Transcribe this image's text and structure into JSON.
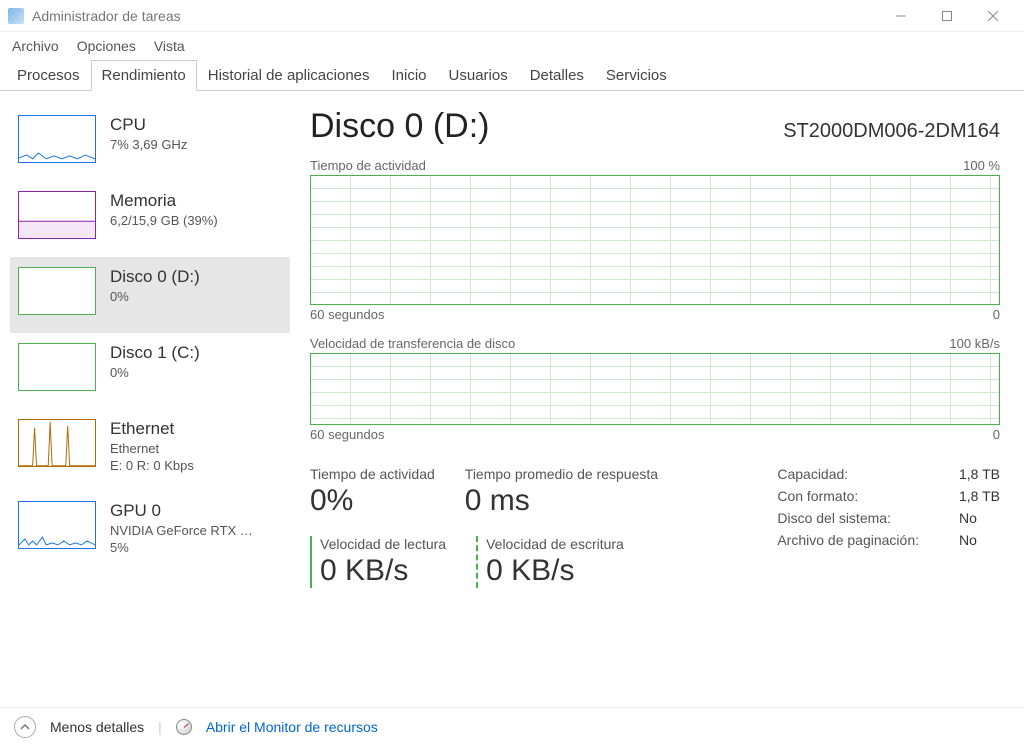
{
  "window": {
    "title": "Administrador de tareas"
  },
  "menu": {
    "file": "Archivo",
    "options": "Opciones",
    "view": "Vista"
  },
  "tabs": {
    "procesos": "Procesos",
    "rendimiento": "Rendimiento",
    "historial": "Historial de aplicaciones",
    "inicio": "Inicio",
    "usuarios": "Usuarios",
    "detalles": "Detalles",
    "servicios": "Servicios"
  },
  "sidebar": {
    "cpu": {
      "title": "CPU",
      "sub": "7%  3,69 GHz"
    },
    "mem": {
      "title": "Memoria",
      "sub": "6,2/15,9 GB (39%)"
    },
    "disk0": {
      "title": "Disco 0 (D:)",
      "sub": "0%"
    },
    "disk1": {
      "title": "Disco 1 (C:)",
      "sub": "0%"
    },
    "eth": {
      "title": "Ethernet",
      "sub1": "Ethernet",
      "sub2": "E: 0  R: 0 Kbps"
    },
    "gpu": {
      "title": "GPU 0",
      "sub1": "NVIDIA GeForce RTX …",
      "sub2": "5%"
    }
  },
  "main": {
    "title": "Disco 0 (D:)",
    "model": "ST2000DM006-2DM164",
    "chart1": {
      "label": "Tiempo de actividad",
      "max": "100 %",
      "xl": "60 segundos",
      "xr": "0"
    },
    "chart2": {
      "label": "Velocidad de transferencia de disco",
      "max": "100 kB/s",
      "xl": "60 segundos",
      "xr": "0"
    },
    "stats": {
      "activity": {
        "label": "Tiempo de actividad",
        "value": "0%"
      },
      "response": {
        "label": "Tiempo promedio de respuesta",
        "value": "0 ms"
      },
      "read": {
        "label": "Velocidad de lectura",
        "value": "0 KB/s"
      },
      "write": {
        "label": "Velocidad de escritura",
        "value": "0 KB/s"
      }
    },
    "info": {
      "capacity_l": "Capacidad:",
      "capacity_v": "1,8 TB",
      "formatted_l": "Con formato:",
      "formatted_v": "1,8 TB",
      "sysdisk_l": "Disco del sistema:",
      "sysdisk_v": "No",
      "pagefile_l": "Archivo de paginación:",
      "pagefile_v": "No"
    }
  },
  "footer": {
    "less": "Menos detalles",
    "resmon": "Abrir el Monitor de recursos"
  },
  "chart_data": [
    {
      "type": "line",
      "title": "Tiempo de actividad",
      "xlabel": "segundos",
      "ylabel": "%",
      "xlim": [
        0,
        60
      ],
      "ylim": [
        0,
        100
      ],
      "series": [
        {
          "name": "Disco 0",
          "values": []
        }
      ]
    },
    {
      "type": "line",
      "title": "Velocidad de transferencia de disco",
      "xlabel": "segundos",
      "ylabel": "kB/s",
      "xlim": [
        0,
        60
      ],
      "ylim": [
        0,
        100
      ],
      "series": [
        {
          "name": "Disco 0",
          "values": []
        }
      ]
    }
  ]
}
